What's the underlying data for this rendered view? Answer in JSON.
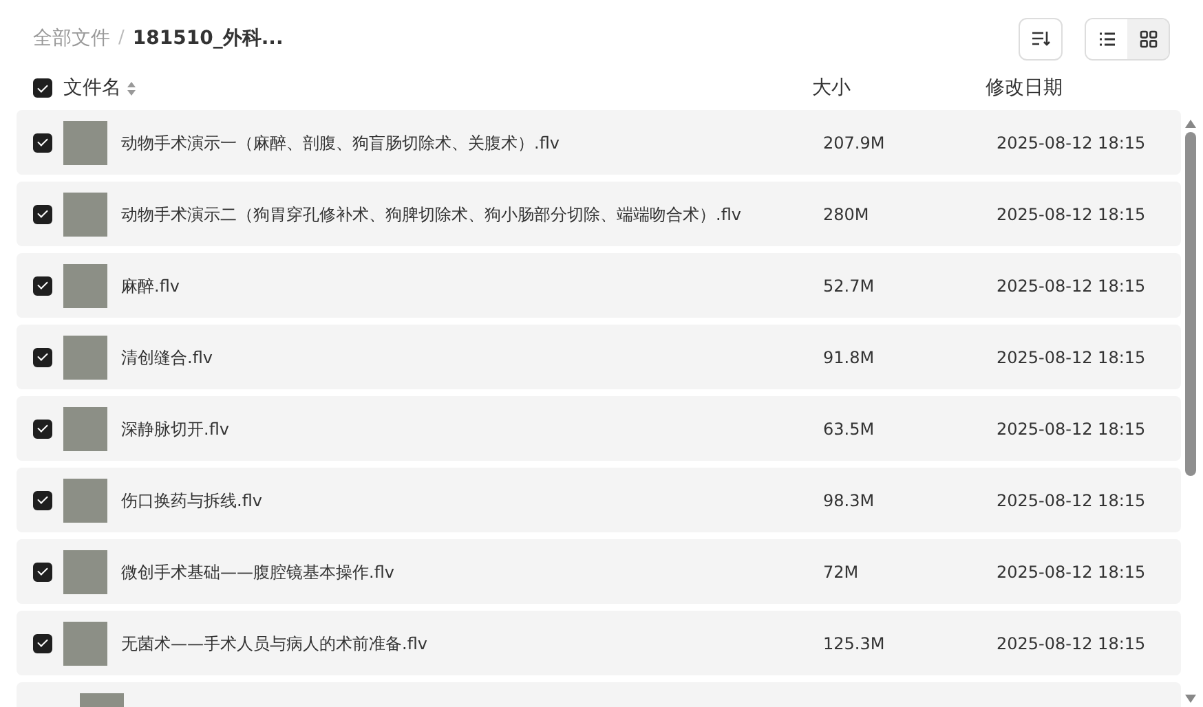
{
  "breadcrumb": [
    {
      "label": "全部文件",
      "current": false
    },
    {
      "label": "181510_外科...",
      "current": true
    }
  ],
  "breadcrumb_separator": "/",
  "view_buttons": [
    {
      "kind": "list",
      "selected": false
    },
    {
      "kind": "grid",
      "selected": true
    }
  ],
  "columns": {
    "select_all": {
      "checked": true
    },
    "name": "文件名",
    "size": "大小",
    "modified": "修改日期"
  },
  "files": [
    {
      "name": "动物手术演示一（麻醉、剖腹、狗盲肠切除术、关腹术）.flv",
      "size": "207.9M",
      "modified": "2025-08-12 18:15",
      "checked": true
    },
    {
      "name": "动物手术演示二（狗胃穿孔修补术、狗脾切除术、狗小肠部分切除、端端吻合术）.flv",
      "size": "280M",
      "modified": "2025-08-12 18:15",
      "checked": true
    },
    {
      "name": "麻醉.flv",
      "size": "52.7M",
      "modified": "2025-08-12 18:15",
      "checked": true
    },
    {
      "name": "清创缝合.flv",
      "size": "91.8M",
      "modified": "2025-08-12 18:15",
      "checked": true
    },
    {
      "name": "深静脉切开.flv",
      "size": "63.5M",
      "modified": "2025-08-12 18:15",
      "checked": true
    },
    {
      "name": "伤口换药与拆线.flv",
      "size": "98.3M",
      "modified": "2025-08-12 18:15",
      "checked": true
    },
    {
      "name": "微创手术基础——腹腔镜基本操作.flv",
      "size": "72M",
      "modified": "2025-08-12 18:15",
      "checked": true
    },
    {
      "name": "无菌术——手术人员与病人的术前准备.flv",
      "size": "125.3M",
      "modified": "2025-08-12 18:15",
      "checked": true
    }
  ]
}
